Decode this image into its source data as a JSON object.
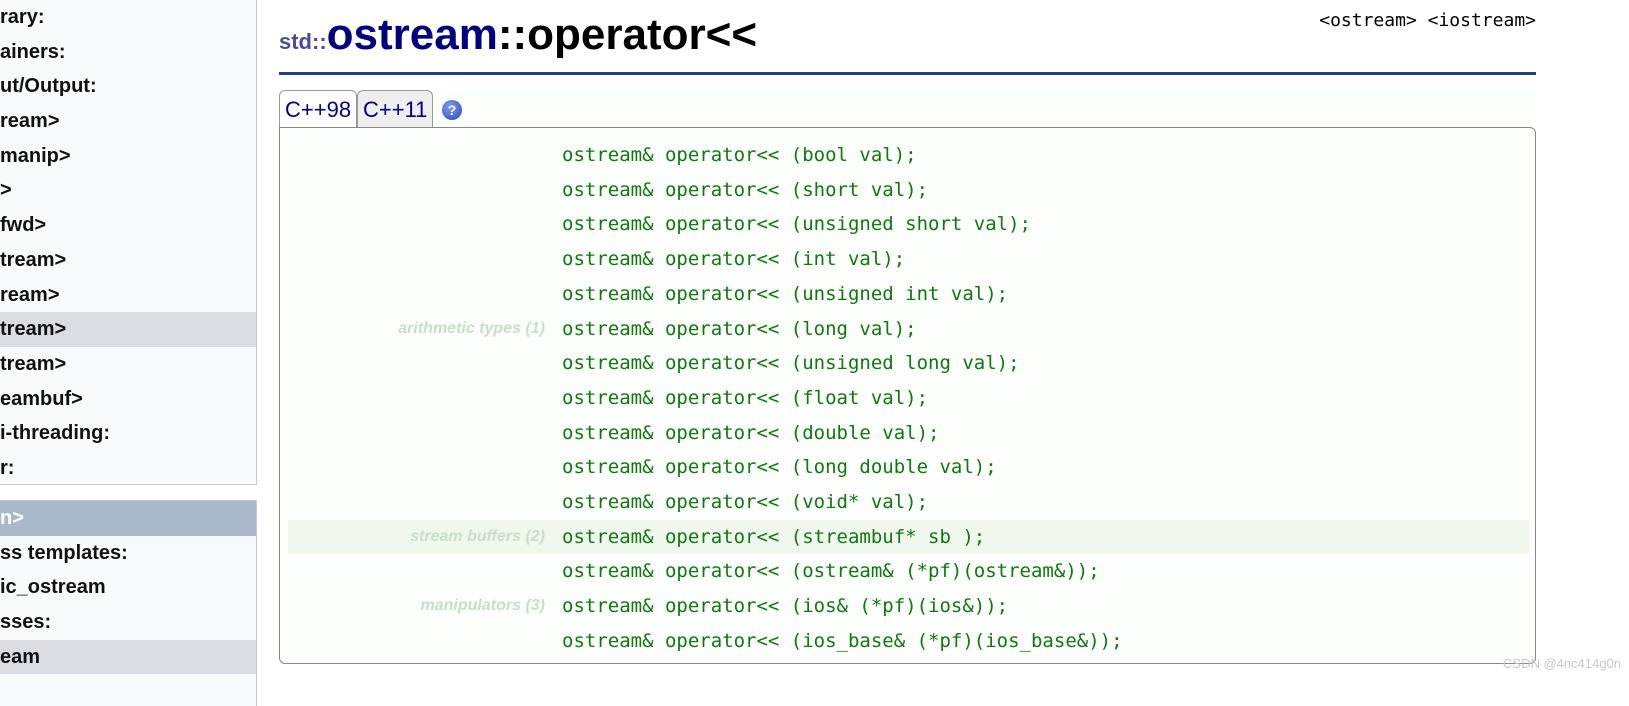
{
  "sidebar": {
    "top_items": [
      {
        "label": "rary:"
      },
      {
        "label": "ainers:"
      },
      {
        "label": "ut/Output:"
      },
      {
        "label": "ream>"
      },
      {
        "label": "manip>"
      },
      {
        "label": ">"
      },
      {
        "label": "fwd>"
      },
      {
        "label": "tream>"
      },
      {
        "label": "ream>"
      },
      {
        "label": "tream>",
        "selected": true
      },
      {
        "label": "tream>"
      },
      {
        "label": "eambuf>"
      },
      {
        "label": "i-threading:"
      },
      {
        "label": "r:"
      }
    ],
    "bottom_items": [
      {
        "label": "n>",
        "header": true
      },
      {
        "label": "ss templates:"
      },
      {
        "label": "ic_ostream"
      },
      {
        "label": "sses:"
      },
      {
        "label": "eam",
        "selected": true
      }
    ]
  },
  "title": {
    "namespace": "std::",
    "class": "ostream",
    "member": "::operator<<"
  },
  "headers": "<ostream> <iostream>",
  "tabs": [
    {
      "label": "C++98",
      "active": true
    },
    {
      "label": "C++11"
    }
  ],
  "help_icon": "question-circle-icon",
  "groups": [
    {
      "label": "arithmetic types (1)",
      "lines": [
        "ostream& operator<< (bool val);",
        "ostream& operator<< (short val);",
        "ostream& operator<< (unsigned short val);",
        "ostream& operator<< (int val);",
        "ostream& operator<< (unsigned int val);",
        "ostream& operator<< (long val);",
        "ostream& operator<< (unsigned long val);",
        "ostream& operator<< (float val);",
        "ostream& operator<< (double val);",
        "ostream& operator<< (long double val);",
        "ostream& operator<< (void* val);"
      ]
    },
    {
      "label": "stream buffers (2)",
      "lines": [
        "ostream& operator<< (streambuf* sb );"
      ]
    },
    {
      "label": "manipulators (3)",
      "lines": [
        "ostream& operator<< (ostream& (*pf)(ostream&));",
        "ostream& operator<< (ios& (*pf)(ios&));",
        "ostream& operator<< (ios_base& (*pf)(ios_base&));"
      ]
    }
  ],
  "watermark": "CSDN @4nc414g0n",
  "colors": {
    "code": "#117711",
    "title_class": "#000080",
    "rule": "#213f7f"
  }
}
